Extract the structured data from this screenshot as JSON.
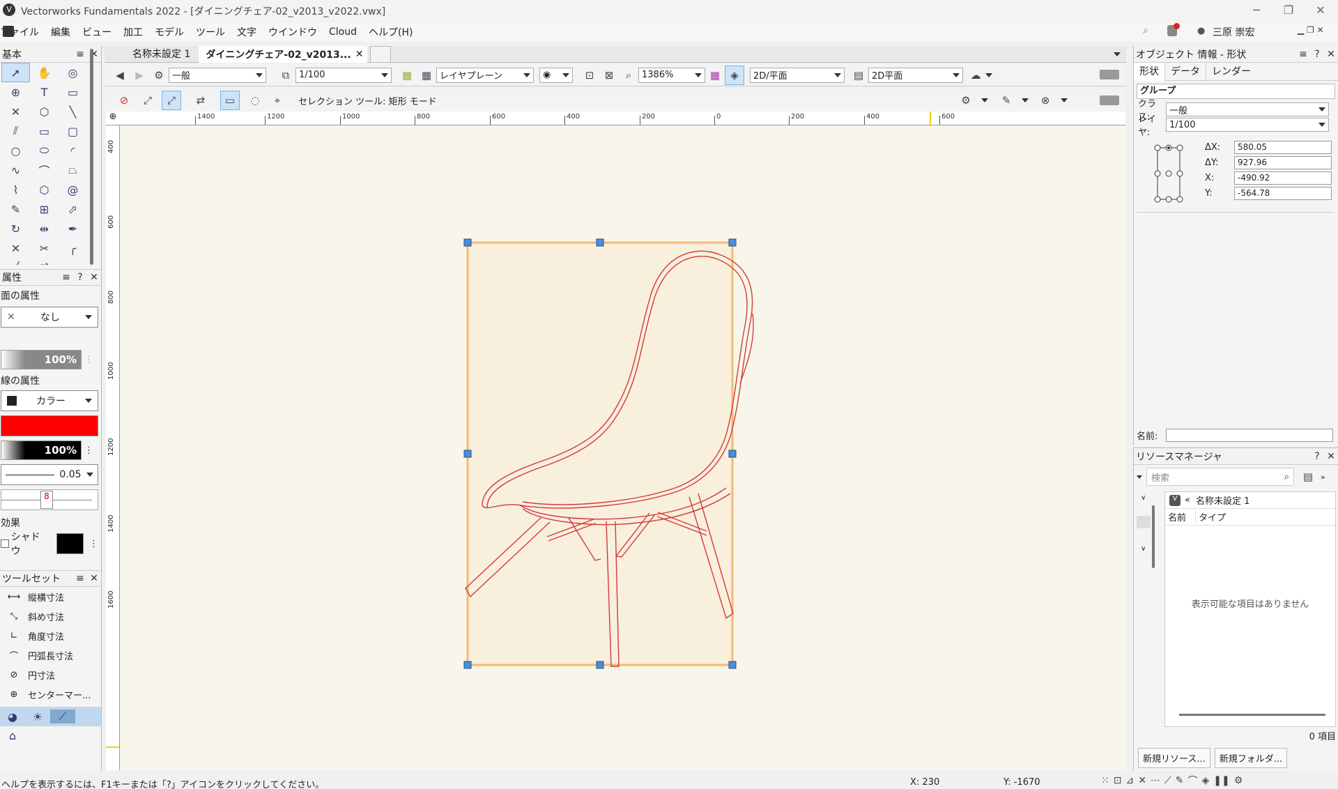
{
  "window": {
    "title": "Vectorworks Fundamentals 2022 - [ダイニングチェア-02_v2013_v2022.vwx]",
    "app_icon": "vectorworks-logo-icon"
  },
  "menu": [
    "ファイル",
    "編集",
    "ビュー",
    "加工",
    "モデル",
    "ツール",
    "文字",
    "ウインドウ",
    "Cloud",
    "ヘルプ(H)"
  ],
  "user": {
    "name": "三原 崇宏"
  },
  "tabs": [
    {
      "label": "名称未設定 1",
      "active": false
    },
    {
      "label": "ダイニングチェア-02_v2013...",
      "active": true
    }
  ],
  "view_bar": {
    "class_value": "一般",
    "layer_value": "1/100",
    "layer_plane": "レイヤプレーン",
    "zoom": "1386%",
    "view_mode": "2D/平面",
    "render_mode": "2D平面"
  },
  "tool_bar": {
    "mode_label": "セレクション ツール: 矩形 モード"
  },
  "rulers": {
    "h_ticks": [
      "1400",
      "1200",
      "1000",
      "800",
      "600",
      "400",
      "200",
      "0",
      "200",
      "400",
      "600"
    ],
    "v_ticks": [
      "400",
      "600",
      "800",
      "1000",
      "1200",
      "1400",
      "1600"
    ]
  },
  "basic_palette": {
    "title": "基本"
  },
  "attributes": {
    "title": "属性",
    "fill_label": "面の属性",
    "fill_value": "なし",
    "fill_opacity": "100%",
    "line_label": "線の属性",
    "line_type": "カラー",
    "line_color": "#ff0000",
    "line_opacity": "100%",
    "line_weight": "0.05",
    "effects_label": "効果",
    "shadow_label": "シャドウ"
  },
  "toolset": {
    "title": "ツールセット",
    "items": [
      "縦横寸法",
      "斜め寸法",
      "角度寸法",
      "円弧長寸法",
      "円寸法",
      "センターマー..."
    ]
  },
  "obj_info": {
    "title": "オブジェクト 情報 - 形状",
    "tabs": [
      "形状",
      "データ",
      "レンダー"
    ],
    "object_type": "グループ",
    "class_label": "クラス:",
    "class_value": "一般",
    "layer_label": "レイヤ:",
    "layer_value": "1/100",
    "dx_label": "ΔX:",
    "dx": "580.05",
    "dy_label": "ΔY:",
    "dy": "927.96",
    "x_label": "X:",
    "x": "-490.92",
    "y_label": "Y:",
    "y": "-564.78",
    "name_label": "名前:"
  },
  "resource": {
    "title": "リソースマネージャ",
    "search_placeholder": "検索",
    "file": "名称未設定 1",
    "col_name": "名前",
    "col_type": "タイプ",
    "empty": "表示可能な項目はありません",
    "count": "0 項目",
    "new_resource": "新規リソース...",
    "new_folder": "新規フォルダ..."
  },
  "status": {
    "help": "ヘルプを表示するには、F1キーまたは「?」アイコンをクリックしてください。",
    "x": "X: 230",
    "y": "Y: -1670"
  },
  "colors": {
    "selection": "#f5b971",
    "chair": "#d23a3a",
    "canvas": "#f8f6ea",
    "handle": "#4a8fdc"
  }
}
